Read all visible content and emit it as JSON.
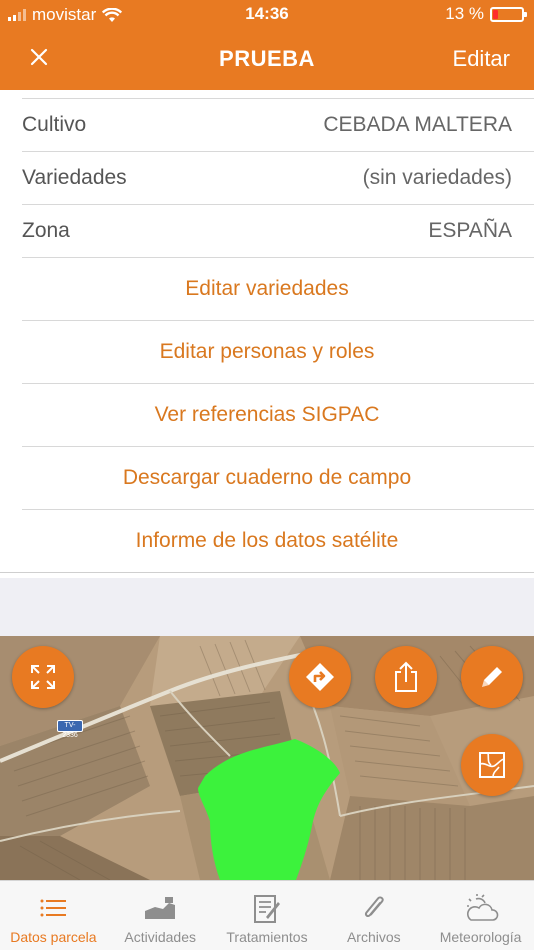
{
  "status_bar": {
    "carrier": "movistar",
    "time": "14:36",
    "battery": "13 %",
    "battery_level": 0.13
  },
  "nav": {
    "close_icon": "close-icon",
    "title": "PRUEBA",
    "edit_label": "Editar"
  },
  "details": [
    {
      "label": "Cultivo",
      "value": "CEBADA MALTERA"
    },
    {
      "label": "Variedades",
      "value": "(sin variedades)"
    },
    {
      "label": "Zona",
      "value": "ESPAÑA"
    }
  ],
  "actions": [
    "Editar variedades",
    "Editar personas y roles",
    "Ver referencias SIGPAC",
    "Descargar cuaderno de campo",
    "Informe de los datos satélite"
  ],
  "map": {
    "road_label": "TV-2336",
    "buttons": [
      "expand-icon",
      "directions-icon",
      "share-icon",
      "pencil-icon",
      "map-layers-icon"
    ],
    "parcel_color": "#3cf23c"
  },
  "tabs": [
    {
      "label": "Datos parcela",
      "icon": "list-icon",
      "active": true
    },
    {
      "label": "Actividades",
      "icon": "activities-icon",
      "active": false
    },
    {
      "label": "Tratamientos",
      "icon": "treatments-icon",
      "active": false
    },
    {
      "label": "Archivos",
      "icon": "paperclip-icon",
      "active": false
    },
    {
      "label": "Meteorología",
      "icon": "weather-icon",
      "active": false
    }
  ],
  "colors": {
    "accent": "#e87a22",
    "action_text": "#d9781f",
    "tab_inactive": "#8e8e8e"
  }
}
